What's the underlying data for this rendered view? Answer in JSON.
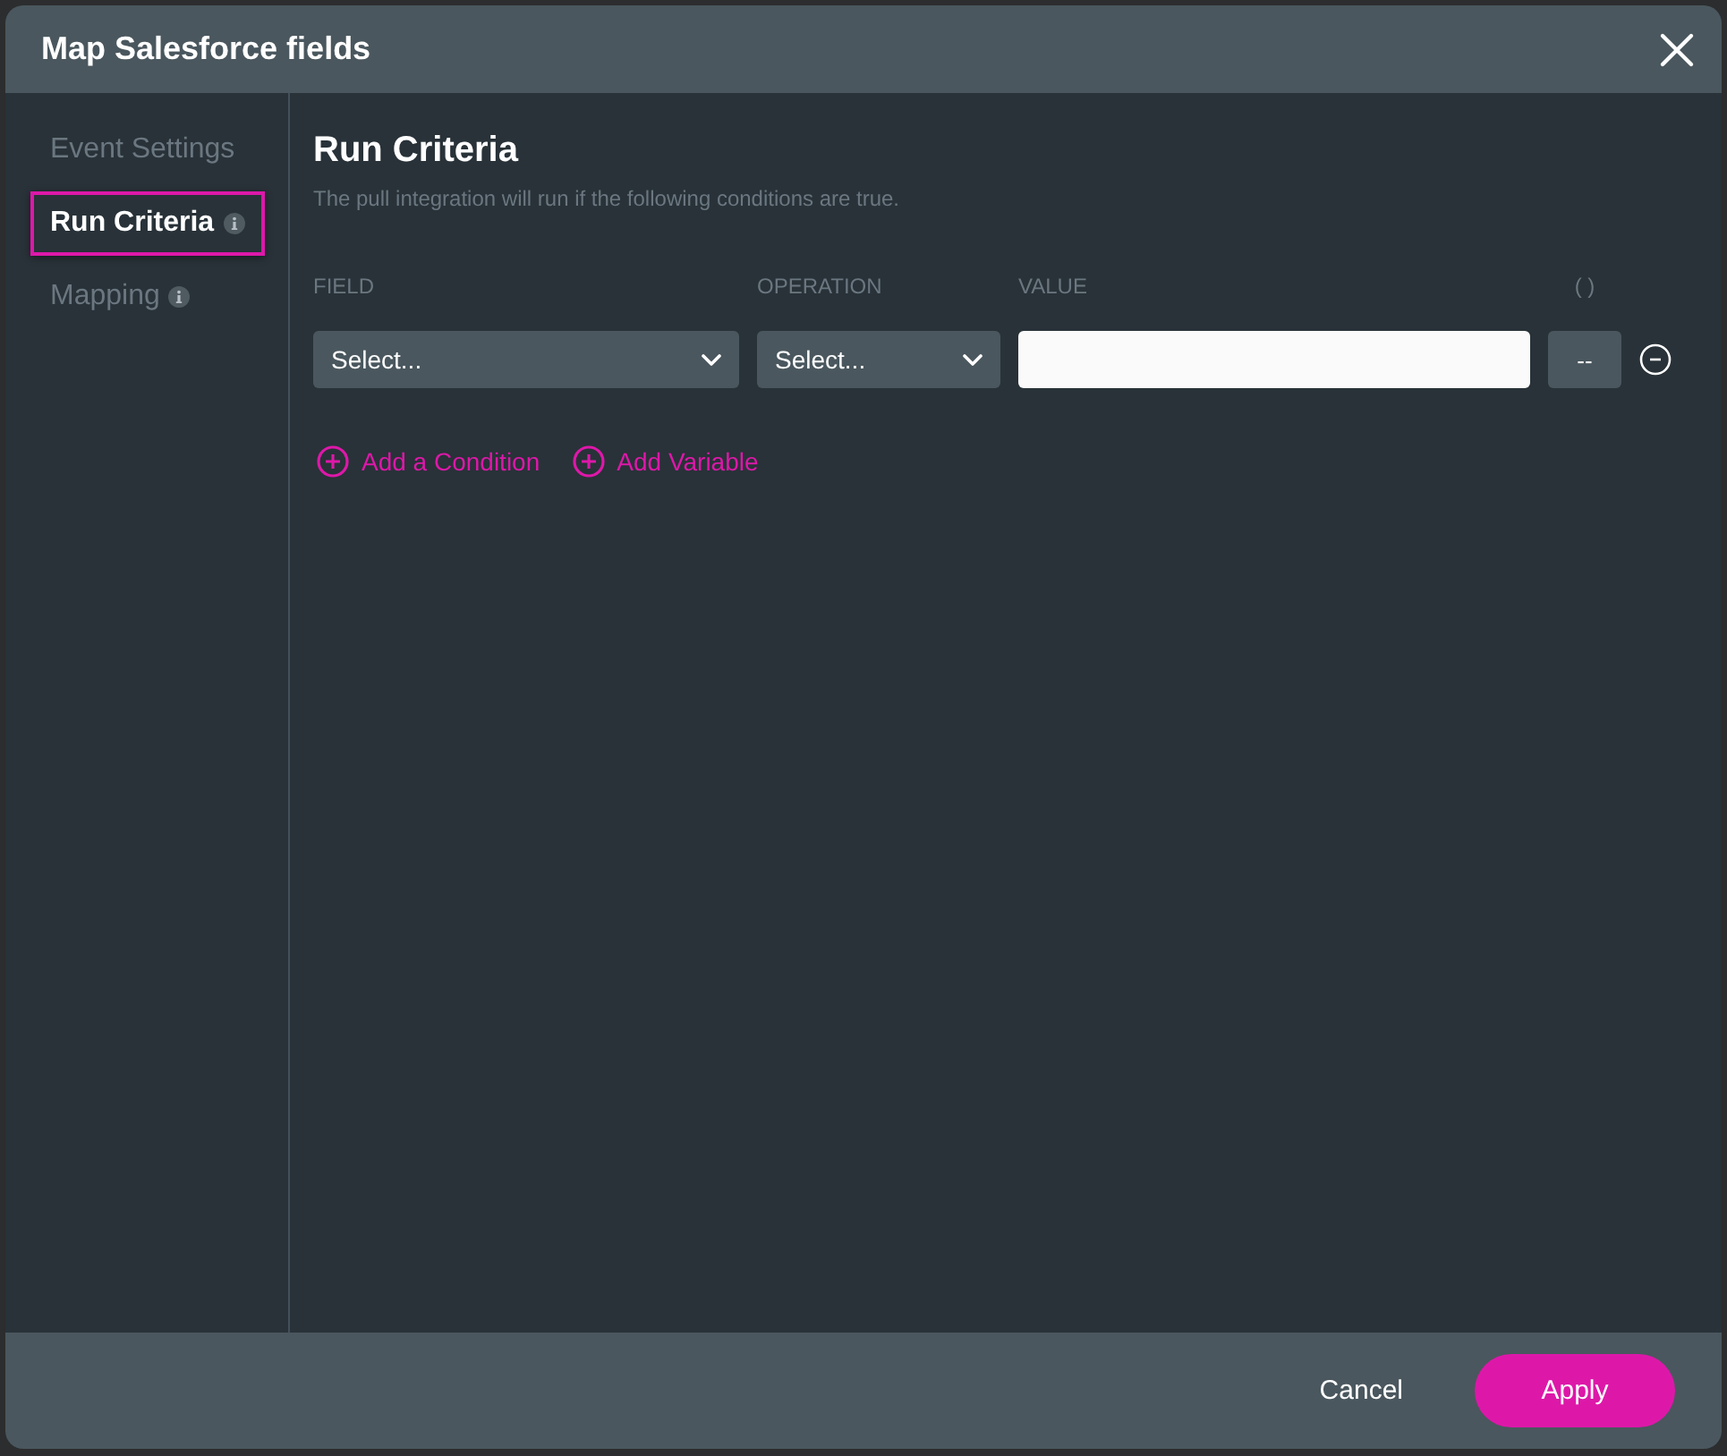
{
  "window": {
    "title": "Map Salesforce fields"
  },
  "sidebar": {
    "items": [
      {
        "label": "Event Settings",
        "selected": false,
        "info": false
      },
      {
        "label": "Run Criteria",
        "selected": true,
        "info": true
      },
      {
        "label": "Mapping",
        "selected": false,
        "info": true
      }
    ]
  },
  "section": {
    "title": "Run Criteria",
    "description": "The pull integration will run if the following conditions are true.",
    "columns": [
      "FIELD",
      "OPERATION",
      "VALUE",
      "( )"
    ],
    "conditions": [
      {
        "field": {
          "value": "Select..."
        },
        "operation": {
          "value": "Select..."
        },
        "parentheses": "--"
      }
    ],
    "actions": [
      {
        "label": "Add a Condition"
      },
      {
        "label": "Add Variable"
      }
    ]
  },
  "footer": {
    "buttons": [
      {
        "label": "Cancel",
        "kind": "text"
      },
      {
        "label": "Apply",
        "kind": "primary"
      }
    ]
  }
}
